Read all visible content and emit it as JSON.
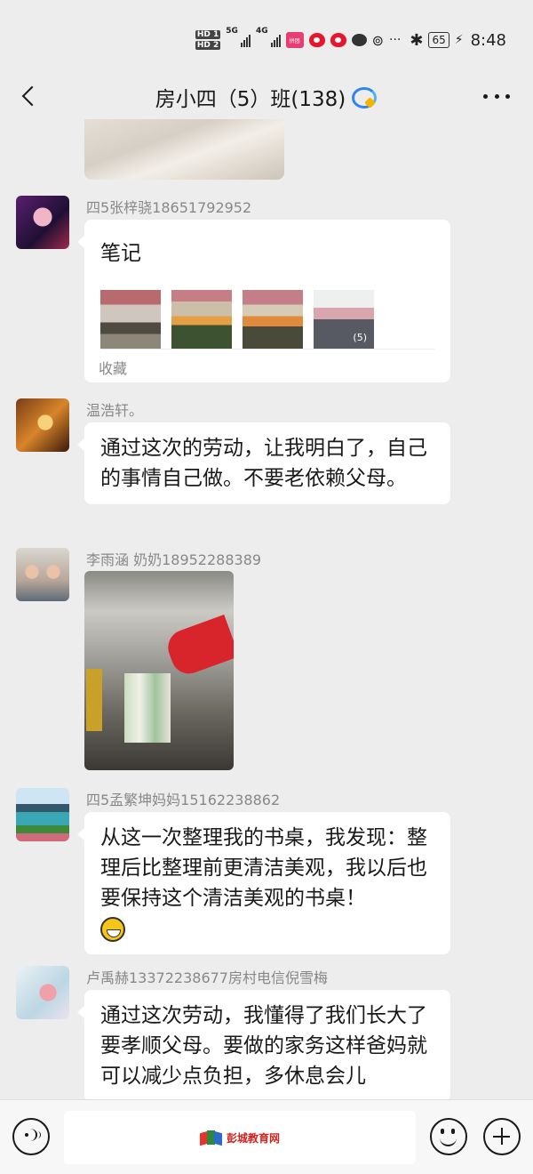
{
  "status_bar": {
    "hd1": "HD 1",
    "hd2": "HD 2",
    "net1": "5G",
    "net2": "4G",
    "app_badge": "拼团",
    "more": "···",
    "battery": "65",
    "time": "8:48"
  },
  "nav": {
    "title": "房小四（5）班(138)"
  },
  "messages": [
    {
      "sender": "四5张梓骁18651792952",
      "note_title": "笔记",
      "thumb_count": "(5)",
      "note_footer": "收藏"
    },
    {
      "sender": "温浩轩。",
      "text": "通过这次的劳动，让我明白了，自己的事情自己做。不要老依赖父母。"
    },
    {
      "sender": "李雨涵  奶奶18952288389"
    },
    {
      "sender": "四5孟繁坤妈妈15162238862",
      "text": "从这一次整理我的书桌，我发现：整理后比整理前更清洁美观，我以后也要保持这个清洁美观的书桌！"
    },
    {
      "sender": "卢禹赫13372238677房村电信倪雪梅",
      "text": "通过这次劳动，我懂得了我们长大了要孝顺父母。要做的家务这样爸妈就可以减少点负担，多休息会儿"
    }
  ],
  "watermark": "彭城教育网",
  "colors": {
    "background": "#ededed",
    "bubble": "#ffffff",
    "sender": "#888888",
    "watermark": "#d0221f"
  }
}
